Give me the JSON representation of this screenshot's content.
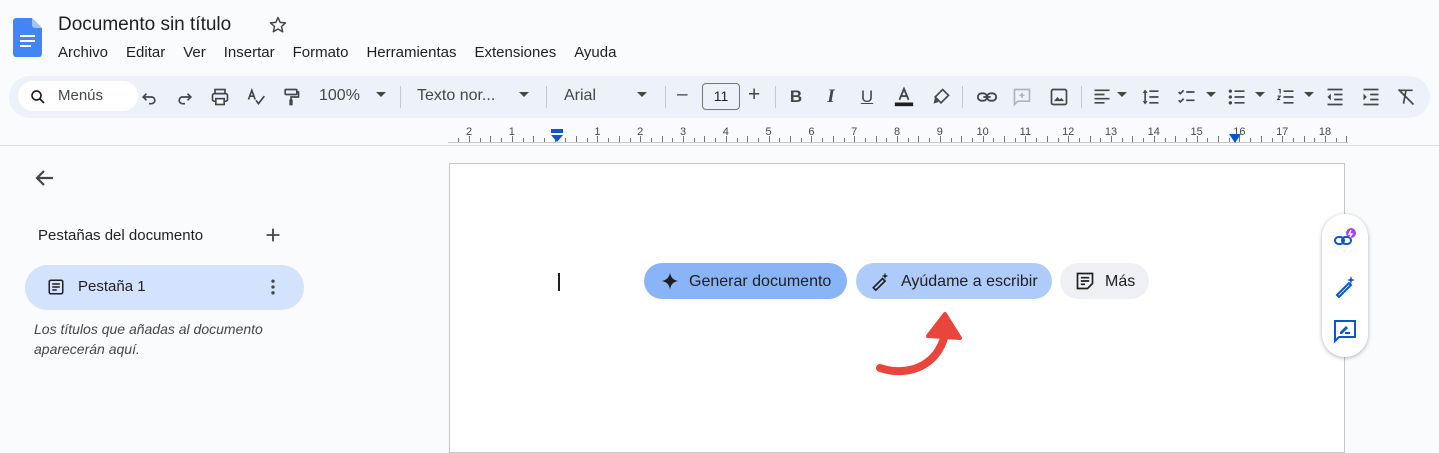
{
  "document": {
    "title": "Documento sin título"
  },
  "menu": [
    "Archivo",
    "Editar",
    "Ver",
    "Insertar",
    "Formato",
    "Herramientas",
    "Extensiones",
    "Ayuda"
  ],
  "toolbar": {
    "search_label": "Menús",
    "zoom": "100%",
    "style": "Texto nor...",
    "font": "Arial",
    "font_size": "11",
    "minus": "–",
    "plus": "+"
  },
  "ruler": {
    "labels": [
      "2",
      "1",
      "1",
      "2",
      "3",
      "4",
      "5",
      "6",
      "7",
      "8",
      "9",
      "10",
      "11",
      "12",
      "13",
      "14",
      "15",
      "16",
      "17",
      "18"
    ]
  },
  "sidebar": {
    "heading": "Pestañas del documento",
    "tabs": [
      {
        "label": "Pestaña 1"
      }
    ],
    "hint": "Los títulos que añadas al documento aparecerán aquí."
  },
  "chips": {
    "generate": "Generar documento",
    "help": "Ayúdame a escribir",
    "more": "Más"
  },
  "colors": {
    "accent": "#0b57d0",
    "toolbar_bg": "#edf2fa",
    "chip_generate": "#8ab4f8",
    "chip_help": "#aecbfa",
    "annotation_arrow": "#e8453c"
  },
  "icons": [
    "docs-logo-icon",
    "star-icon",
    "search-icon",
    "undo-icon",
    "redo-icon",
    "print-icon",
    "spellcheck-icon",
    "paint-format-icon",
    "bold-icon",
    "italic-icon",
    "underline-icon",
    "text-color-icon",
    "highlight-icon",
    "link-icon",
    "comment-icon",
    "image-icon",
    "align-icon",
    "line-spacing-icon",
    "checklist-icon",
    "bulleted-list-icon",
    "numbered-list-icon",
    "decrease-indent-icon",
    "increase-indent-icon",
    "clear-format-icon",
    "back-arrow-icon",
    "add-icon",
    "document-icon",
    "more-vert-icon",
    "sparkle-icon",
    "pen-sparkle-icon",
    "note-add-icon",
    "link-ai-icon",
    "pen-icon",
    "rate-review-icon"
  ]
}
